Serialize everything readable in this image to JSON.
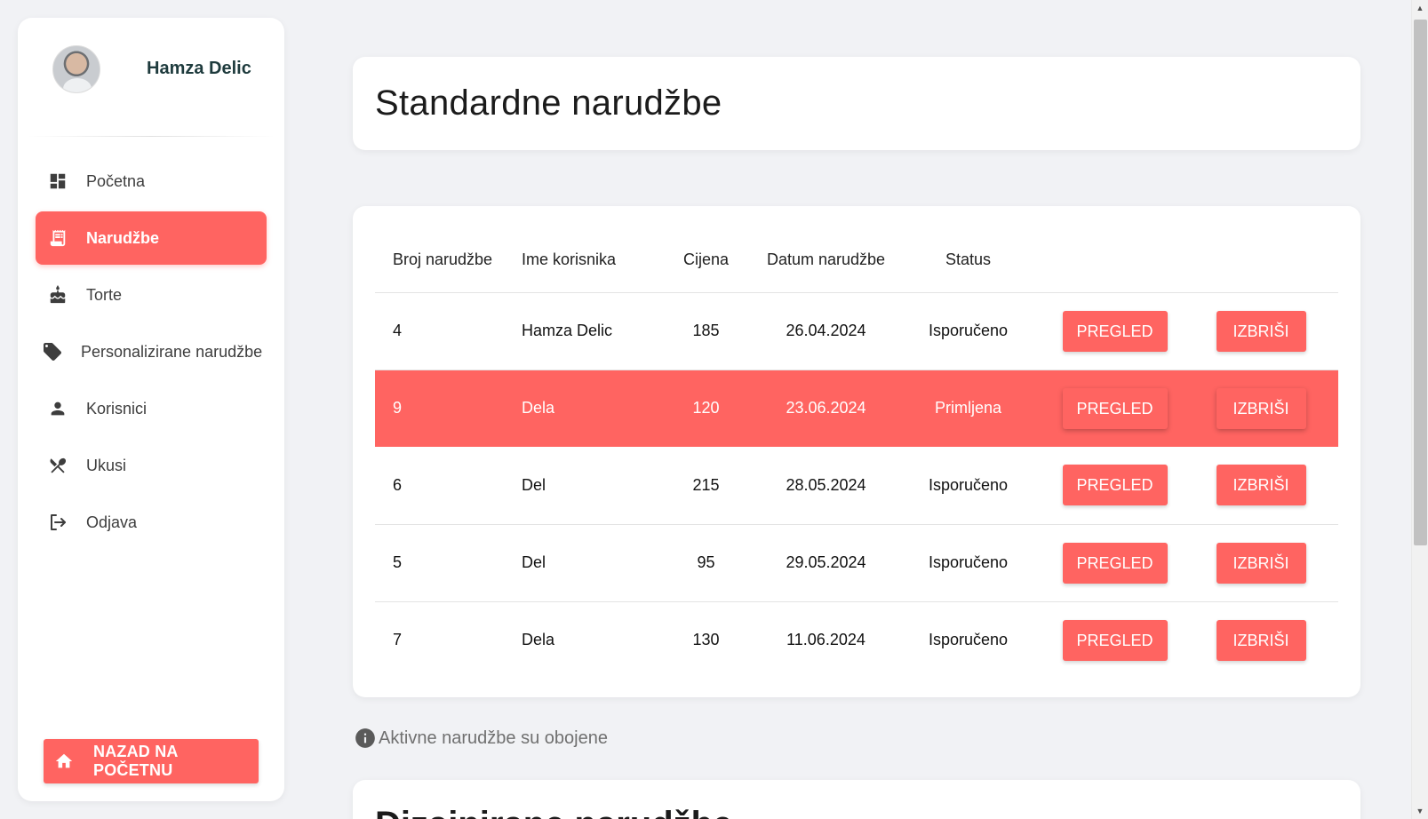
{
  "user": {
    "name": "Hamza Delic"
  },
  "sidebar": {
    "items": [
      {
        "label": "Početna",
        "icon": "dashboard-icon",
        "active": false
      },
      {
        "label": "Narudžbe",
        "icon": "receipt-icon",
        "active": true
      },
      {
        "label": "Torte",
        "icon": "cake-icon",
        "active": false
      },
      {
        "label": "Personalizirane narudžbe",
        "icon": "tag-icon",
        "active": false
      },
      {
        "label": "Korisnici",
        "icon": "person-icon",
        "active": false
      },
      {
        "label": "Ukusi",
        "icon": "utensils-icon",
        "active": false
      },
      {
        "label": "Odjava",
        "icon": "logout-icon",
        "active": false
      }
    ],
    "home_button": "NAZAD NA POČETNU"
  },
  "header": {
    "title": "Standardne narudžbe"
  },
  "table": {
    "columns": [
      "Broj narudžbe",
      "Ime korisnika",
      "Cijena",
      "Datum narudžbe",
      "Status"
    ],
    "rows": [
      {
        "id": "4",
        "name": "Hamza Delic",
        "price": "185",
        "date": "26.04.2024",
        "status": "Isporučeno",
        "active": false
      },
      {
        "id": "9",
        "name": "Dela",
        "price": "120",
        "date": "23.06.2024",
        "status": "Primljena",
        "active": true
      },
      {
        "id": "6",
        "name": "Del",
        "price": "215",
        "date": "28.05.2024",
        "status": "Isporučeno",
        "active": false
      },
      {
        "id": "5",
        "name": "Del",
        "price": "95",
        "date": "29.05.2024",
        "status": "Isporučeno",
        "active": false
      },
      {
        "id": "7",
        "name": "Dela",
        "price": "130",
        "date": "11.06.2024",
        "status": "Isporučeno",
        "active": false
      }
    ],
    "view_label": "PREGLED",
    "delete_label": "IZBRIŠI"
  },
  "note": {
    "text": "Aktivne narudžbe su obojene",
    "icon": "info-icon"
  },
  "bottom_card": {
    "title": "Dizajnirane narudžbe"
  },
  "colors": {
    "accent": "#ff6461",
    "background": "#f1f2f5"
  }
}
